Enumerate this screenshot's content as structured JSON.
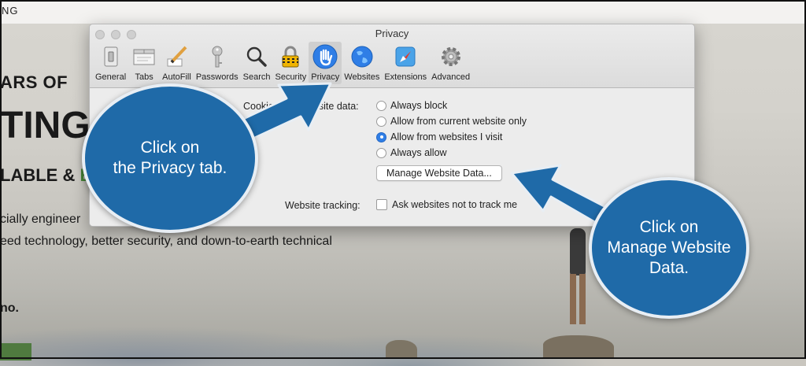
{
  "background": {
    "topbar_text": "NG",
    "headline_1": "ARS OF",
    "headline_2": "TING",
    "headline_3_a": "LABLE &",
    "headline_3_b": "E",
    "paragraph_1": "cially engineer",
    "paragraph_2": "eed technology, better security, and down-to-earth technical",
    "paragraph_3": "no."
  },
  "window": {
    "title": "Privacy",
    "toolbar": [
      {
        "label": "General",
        "icon": "general-switch-icon"
      },
      {
        "label": "Tabs",
        "icon": "tabs-icon"
      },
      {
        "label": "AutoFill",
        "icon": "autofill-pencil-icon"
      },
      {
        "label": "Passwords",
        "icon": "key-icon"
      },
      {
        "label": "Search",
        "icon": "magnifier-icon"
      },
      {
        "label": "Security",
        "icon": "padlock-icon"
      },
      {
        "label": "Privacy",
        "icon": "hand-icon",
        "selected": true
      },
      {
        "label": "Websites",
        "icon": "globe-icon"
      },
      {
        "label": "Extensions",
        "icon": "puzzle-compass-icon"
      },
      {
        "label": "Advanced",
        "icon": "gear-icon"
      }
    ],
    "cookies_label": "Cookies and website data:",
    "cookie_options": [
      "Always block",
      "Allow from current website only",
      "Allow from websites I visit",
      "Always allow"
    ],
    "cookie_selected": "Allow from websites I visit",
    "manage_button": "Manage Website Data...",
    "tracking_label": "Website tracking:",
    "tracking_checkbox": "Ask websites not to track me",
    "tracking_checked": false
  },
  "annotations": {
    "callout_1_line1": "Click on",
    "callout_1_line2": "the Privacy tab.",
    "callout_2_line1": "Click on",
    "callout_2_line2": "Manage Website",
    "callout_2_line3": "Data.",
    "callout_color": "#1f6aa8"
  }
}
